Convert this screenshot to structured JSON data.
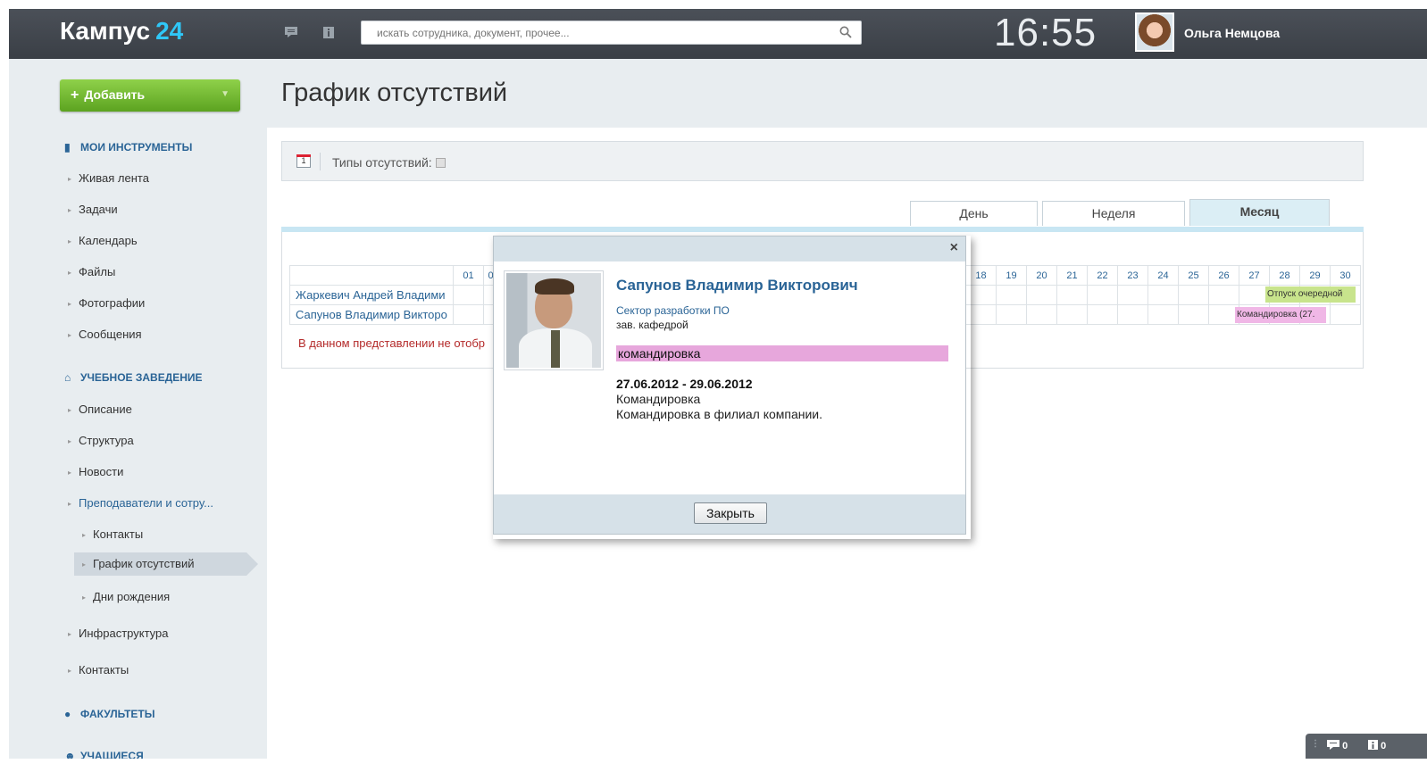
{
  "header": {
    "logo_text": "Кампус",
    "logo_num": "24",
    "search_placeholder": "искать сотрудника, документ, прочее...",
    "time": "16:55",
    "user_name": "Ольга Немцова"
  },
  "sidebar": {
    "add_button": "Добавить",
    "sections": [
      {
        "title": "МОИ ИНСТРУМЕНТЫ",
        "items": [
          "Живая лента",
          "Задачи",
          "Календарь",
          "Файлы",
          "Фотографии",
          "Сообщения"
        ]
      },
      {
        "title": "УЧЕБНОЕ ЗАВЕДЕНИЕ",
        "items": [
          "Описание",
          "Структура",
          "Новости",
          "Преподаватели и сотру...",
          "Контакты",
          "График отсутствий",
          "Дни рождения",
          "Инфраструктура",
          "Контакты"
        ]
      },
      {
        "title": "ФАКУЛЬТЕТЫ"
      },
      {
        "title": "УЧАЩИЕСЯ"
      }
    ]
  },
  "main": {
    "page_title": "График отсутствий",
    "toolbar_calendar_day": "1",
    "toolbar_label": "Типы отсутствий:",
    "tabs": [
      {
        "label": "День",
        "active": false
      },
      {
        "label": "Неделя",
        "active": false
      },
      {
        "label": "Месяц",
        "active": true
      }
    ],
    "calendar": {
      "days_left": [
        "01",
        "0"
      ],
      "days_right": [
        "18",
        "19",
        "20",
        "21",
        "22",
        "23",
        "24",
        "25",
        "26",
        "27",
        "28",
        "29",
        "30"
      ],
      "rows": [
        {
          "name": "Жаркевич Андрей Владими"
        },
        {
          "name": "Сапунов Владимир Викторо"
        }
      ],
      "events": [
        {
          "label": "Отпуск очередной",
          "color": "#c8e48c"
        },
        {
          "label": "Командировка (27.",
          "color": "#f0b7e6"
        }
      ],
      "warning": "В данном представлении не отобр"
    }
  },
  "popup": {
    "close_glyph": "×",
    "name": "Сапунов Владимир Викторович",
    "department": "Сектор разработки ПО",
    "position": "зав. кафедрой",
    "absence_type": "командировка",
    "dates": "27.06.2012 - 29.06.2012",
    "reason": "Командировка",
    "description": "Командировка в филиал компании.",
    "close_button": "Закрыть"
  },
  "widget": {
    "messages_count": "0",
    "notifications_count": "0"
  }
}
